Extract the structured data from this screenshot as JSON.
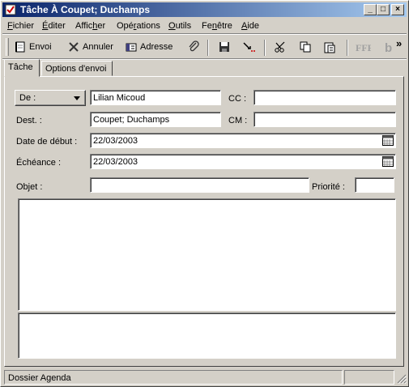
{
  "window": {
    "title": "Tâche À Coupet; Duchamps",
    "controls": {
      "minimize": "_",
      "maximize": "□",
      "close": "×"
    }
  },
  "menu": [
    {
      "label": "Fichier",
      "accel": "F"
    },
    {
      "label": "Éditer",
      "accel": "É"
    },
    {
      "label": "Afficher",
      "accel": "h"
    },
    {
      "label": "Opérations",
      "accel": "r"
    },
    {
      "label": "Outils",
      "accel": "O"
    },
    {
      "label": "Fenêtre",
      "accel": "n"
    },
    {
      "label": "Aide",
      "accel": "A"
    }
  ],
  "toolbar": {
    "send": "Envoi",
    "cancel": "Annuler",
    "address": "Adresse",
    "overflow": "»"
  },
  "tabs": {
    "task": "Tâche",
    "send_options": "Options d'envoi"
  },
  "form": {
    "from_label": "De :",
    "from_value": "Lilian Micoud",
    "cc_label": "CC :",
    "cc_value": "",
    "to_label": "Dest. :",
    "to_value": "Coupet; Duchamps",
    "bcc_label": "CM :",
    "bcc_value": "",
    "start_label": "Date de début :",
    "start_value": "22/03/2003",
    "due_label": "Échéance :",
    "due_value": "22/03/2003",
    "subject_label": "Objet :",
    "subject_value": "",
    "priority_label": "Priorité :",
    "priority_value": ""
  },
  "status": {
    "text": "Dossier Agenda"
  },
  "colors": {
    "title_start": "#0a246a",
    "title_end": "#a6caf0",
    "face": "#d4d0c8"
  }
}
